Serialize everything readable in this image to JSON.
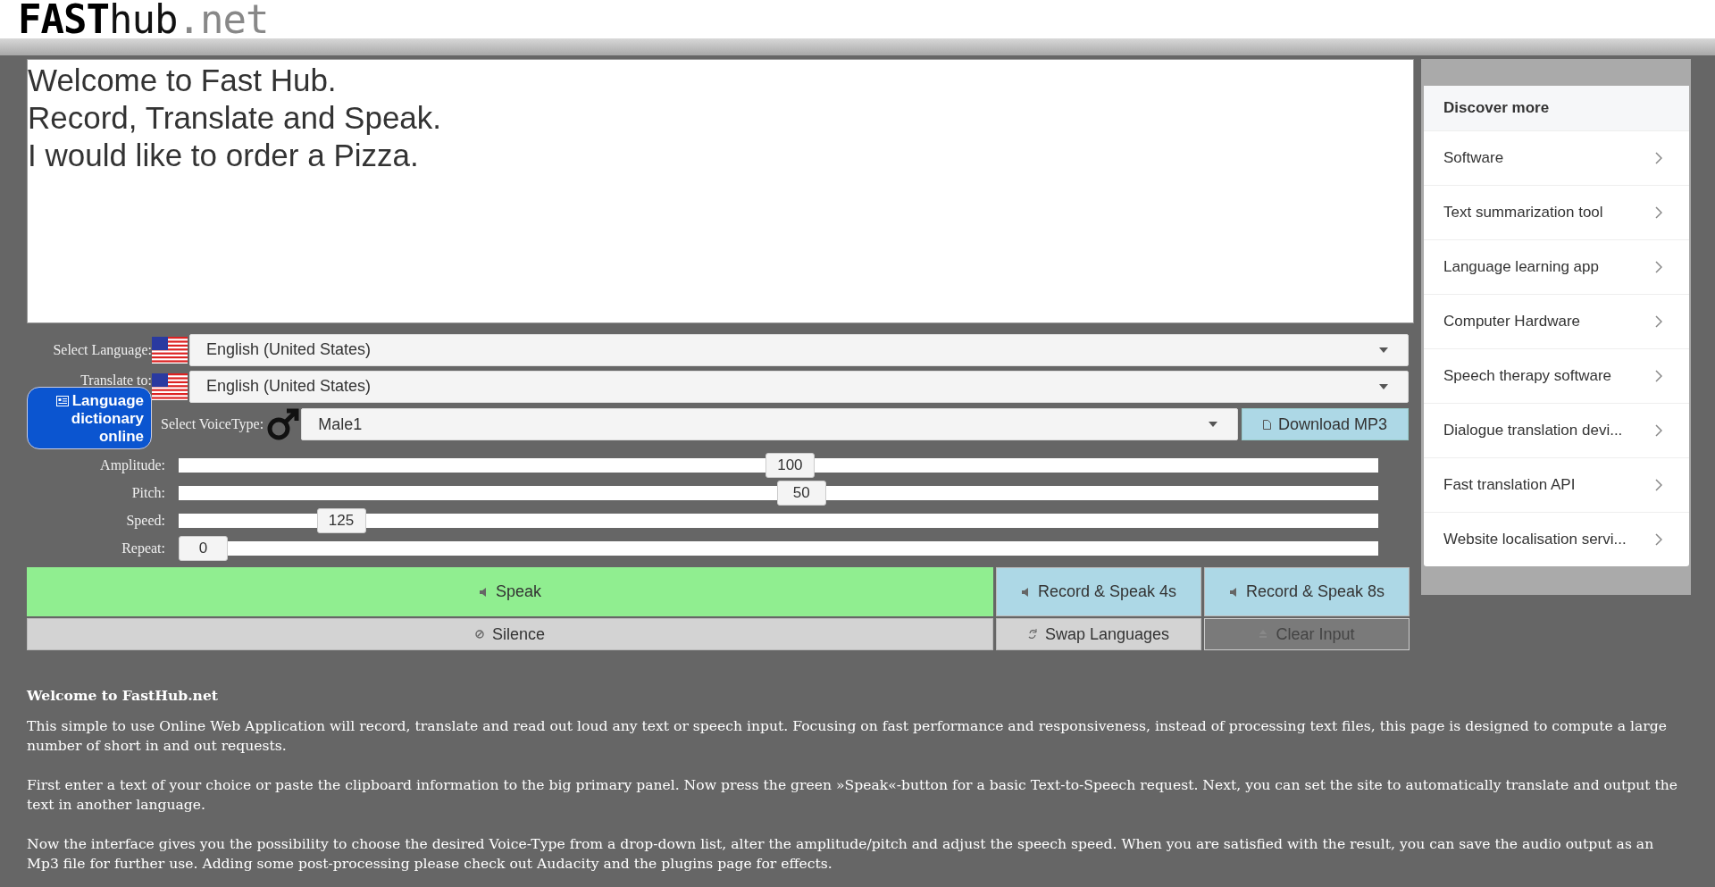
{
  "logo": {
    "bold": "FAST",
    "plain": "hub",
    "suffix": ".net"
  },
  "editor": {
    "lines": [
      "Welcome to Fast Hub.",
      "Record, Translate and Speak.",
      "I would like to order a Pizza."
    ]
  },
  "language": {
    "label": "Select Language:",
    "value": "English (United States)"
  },
  "translate": {
    "label": "Translate to:",
    "value": "English (United States)"
  },
  "dictionary_button": {
    "label": "Language dictionary online"
  },
  "voice": {
    "label": "Select VoiceType:",
    "value": "Male1"
  },
  "download_button": {
    "label": "Download MP3"
  },
  "sliders": [
    {
      "label": "Amplitude:",
      "reading": "100",
      "level": 0.51
    },
    {
      "label": "Pitch:",
      "reading": "50",
      "level": 0.52
    },
    {
      "label": "Speed:",
      "reading": "125",
      "level": 0.12
    },
    {
      "label": "Repeat:",
      "reading": "0",
      "level": 0
    }
  ],
  "buttons": [
    {
      "label": "Speak",
      "kind": "speak",
      "disabled": false
    },
    {
      "label": "Record & Speak 4s",
      "kind": "record",
      "disabled": false
    },
    {
      "label": "Record & Speak 8s",
      "kind": "record",
      "disabled": false
    },
    {
      "label": "Silence",
      "kind": "silence",
      "disabled": false
    },
    {
      "label": "Swap Languages",
      "kind": "swap",
      "disabled": false
    },
    {
      "label": "Clear Input",
      "kind": "clear",
      "disabled": true
    }
  ],
  "discover": {
    "title": "Discover more",
    "items": [
      "Software",
      "Text summarization tool",
      "Language learning app",
      "Computer Hardware",
      "Speech therapy software",
      "Dialogue translation devi...",
      "Fast translation API",
      "Website localisation servi..."
    ]
  },
  "article": {
    "heading": "Welcome to FastHub.net",
    "paragraphs": [
      "This simple to use Online Web Application will record, translate and read out loud any text or speech input. Focusing on fast performance and responsiveness, instead of processing text files, this page is designed to compute a large number of short in and out requests.",
      "First enter a text of your choice or paste the clipboard information to the big primary panel. Now press the green »Speak«-button for a basic Text-to-Speech request. Next, you can set the site to automatically translate and output the text in another language.",
      "Now the interface gives you the possibility to choose the desired Voice-Type from a drop-down list, alter the amplitude/pitch and adjust the speech speed. When you are satisfied with the result, you can save the audio output as an Mp3 file for further use. Adding some post-processing please check out Audacity and the plugins page for effects."
    ]
  }
}
